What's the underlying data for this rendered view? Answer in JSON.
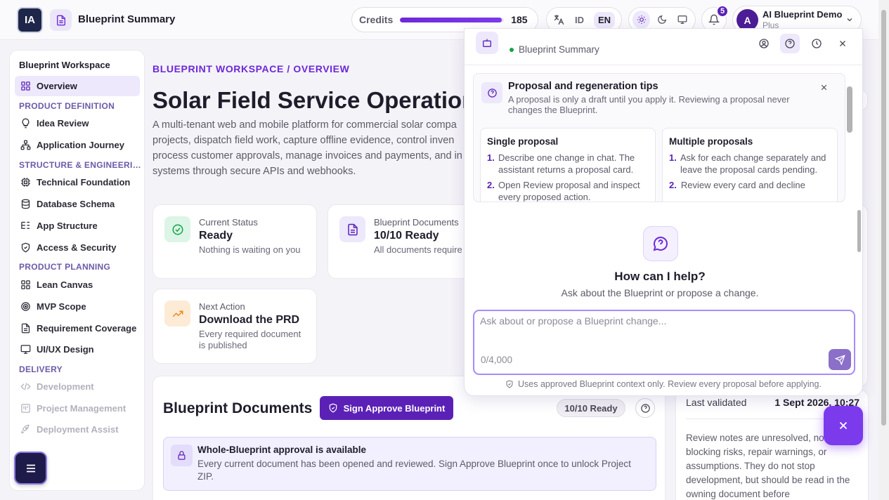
{
  "header": {
    "logo_text": "IA",
    "title": "Blueprint Summary",
    "credits_label": "Credits",
    "credits_value": "185",
    "credits_fraction": 0.98,
    "lang_icon": "translate-icon",
    "lang_options": [
      "ID",
      "EN"
    ],
    "lang_selected": "EN",
    "theme_icons": [
      "sun-icon",
      "moon-icon",
      "monitor-icon"
    ],
    "notification_count": "5",
    "user_initial": "A",
    "user_name": "AI Blueprint Demo",
    "user_plan": "Plus"
  },
  "sidebar": {
    "heading": "Blueprint Workspace",
    "overview": "Overview",
    "sections": {
      "definition": "PRODUCT DEFINITION",
      "structure": "STRUCTURE & ENGINEERING",
      "planning": "PRODUCT PLANNING",
      "delivery": "DELIVERY"
    },
    "items": {
      "idea_review": "Idea Review",
      "application_journey": "Application Journey",
      "technical_foundation": "Technical Foundation",
      "database_schema": "Database Schema",
      "app_structure": "App Structure",
      "access_security": "Access & Security",
      "lean_canvas": "Lean Canvas",
      "mvp_scope": "MVP Scope",
      "requirement_coverage": "Requirement Coverage",
      "uiux_design": "UI/UX Design",
      "development": "Development",
      "project_management": "Project Management",
      "deployment_assist": "Deployment Assist"
    }
  },
  "main": {
    "breadcrumb": "BLUEPRINT WORKSPACE / OVERVIEW",
    "title": "Solar Field Service Operations",
    "description": "A multi-tenant web and mobile platform for commercial solar compa projects, dispatch field work, capture offline evidence, control inven process customer approvals, manage invoices and payments, and in systems through secure APIs and webhooks.",
    "status_card": {
      "label": "Current Status",
      "value": "Ready",
      "sub": "Nothing is waiting on you"
    },
    "docs_card": {
      "label": "Blueprint Documents",
      "value": "10/10 Ready",
      "sub": "All documents require"
    },
    "next_card": {
      "label": "Next Action",
      "value": "Download the PRD",
      "sub": "Every required document is published"
    },
    "documents": {
      "title": "Blueprint Documents",
      "sign_button": "Sign Approve Blueprint",
      "ready_badge": "10/10 Ready",
      "notice_title": "Whole-Blueprint approval is available",
      "notice_text": "Every current document has been opened and reviewed. Sign Approve Blueprint once to unlock Project ZIP."
    },
    "validation": {
      "label": "Last validated",
      "value": "1 Sept 2026, 10:27",
      "note": "Review notes are unresolved, non-blocking risks, repair warnings, or assumptions. They do not stop development, but should be read in the owning document before"
    }
  },
  "chat": {
    "subtitle": "Blueprint Summary",
    "tips": {
      "title": "Proposal and regeneration tips",
      "desc": "A proposal is only a draft until you apply it. Reviewing a proposal never changes the Blueprint.",
      "single_title": "Single proposal",
      "single_1": "Describe one change in chat. The assistant returns a proposal card.",
      "single_2": "Open Review proposal and inspect every proposed action.",
      "multi_title": "Multiple proposals",
      "multi_1": "Ask for each change separately and leave the proposal cards pending.",
      "multi_2": "Review every card and decline"
    },
    "empty_title": "How can I help?",
    "empty_desc": "Ask about the Blueprint or propose a change.",
    "input_placeholder": "Ask about or propose a Blueprint change...",
    "char_count": "0/4,000",
    "footer": "Uses approved Blueprint context only. Review every proposal before applying."
  }
}
